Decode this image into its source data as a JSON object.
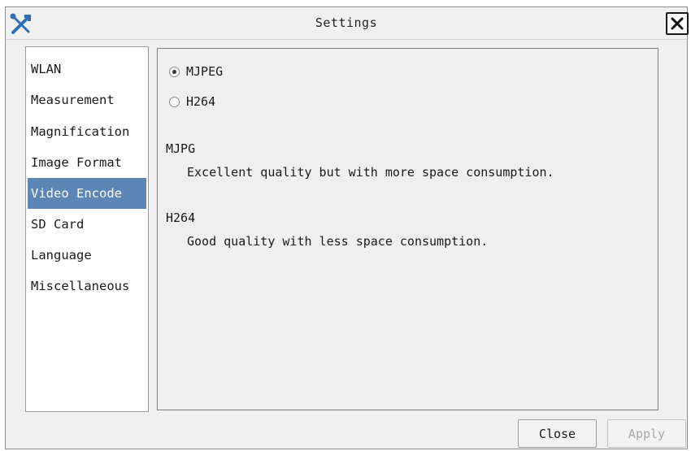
{
  "window": {
    "title": "Settings"
  },
  "icons": {
    "app": "tools-icon",
    "close": "close-icon",
    "app_color": "#2f6fb8"
  },
  "sidebar": {
    "items": [
      {
        "label": "WLAN"
      },
      {
        "label": "Measurement"
      },
      {
        "label": "Magnification"
      },
      {
        "label": "Image Format"
      },
      {
        "label": "Video Encode",
        "selected": true
      },
      {
        "label": "SD Card"
      },
      {
        "label": "Language"
      },
      {
        "label": "Miscellaneous"
      }
    ]
  },
  "panel": {
    "options": [
      {
        "label": "MJPEG",
        "checked": true
      },
      {
        "label": "H264",
        "checked": false
      }
    ],
    "descriptions": [
      {
        "title": "MJPG",
        "text": "Excellent quality but with more space consumption."
      },
      {
        "title": "H264",
        "text": "Good quality with less space consumption."
      }
    ]
  },
  "buttons": {
    "close": "Close",
    "apply": "Apply"
  },
  "colors": {
    "selection": "#5b86b5",
    "disabled_text": "#a8a8a8"
  }
}
